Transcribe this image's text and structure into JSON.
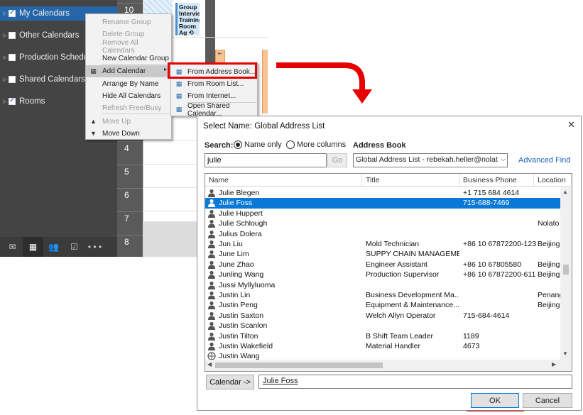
{
  "nav": {
    "folders": [
      {
        "label": "My Calendars",
        "checked": true,
        "selected": true
      },
      {
        "label": "Other Calendars",
        "checked": false,
        "selected": false
      },
      {
        "label": "Production Schedul",
        "checked": false,
        "selected": false
      },
      {
        "label": "Shared Calendars",
        "checked": false,
        "selected": false
      },
      {
        "label": "Rooms",
        "checked": true,
        "selected": false
      }
    ],
    "bar_icons": [
      "mail-icon",
      "calendar-icon",
      "people-icon",
      "tasks-icon",
      "more-icon"
    ],
    "more_glyph": "• • •"
  },
  "calendar": {
    "day_numbers": [
      "10",
      "4",
      "5",
      "6",
      "7",
      "8"
    ],
    "appointment_text": "Group Intervie Training Room",
    "appointment_extra": "Ag ⟲ ⊘"
  },
  "context_menu": {
    "items": [
      {
        "label": "Rename Group",
        "disabled": true
      },
      {
        "label": "Delete Group",
        "disabled": true
      },
      {
        "label": "Remove All Calendars",
        "disabled": true
      },
      {
        "label": "New Calendar Group",
        "disabled": false
      },
      {
        "label": "Add Calendar",
        "disabled": false
      },
      {
        "label": "Arrange By Name",
        "disabled": false
      },
      {
        "label": "Hide All Calendars",
        "disabled": false
      },
      {
        "label": "Refresh Free/Busy",
        "disabled": true
      },
      {
        "label": "Move Up",
        "disabled": true
      },
      {
        "label": "Move Down",
        "disabled": false
      }
    ]
  },
  "submenu": {
    "items": [
      {
        "label": "From Address Book..."
      },
      {
        "label": "From Room List..."
      },
      {
        "label": "From Internet..."
      },
      {
        "label": "Open Shared Calendar..."
      }
    ]
  },
  "dialog": {
    "title": "Select Name: Global Address List",
    "close_glyph": "✕",
    "search_label": "Search:",
    "radio_name_only": "Name only",
    "radio_more_columns": "More columns",
    "address_book_label": "Address Book",
    "search_value": "julie",
    "go_label": "Go",
    "address_book_value": "Global Address List - rebekah.heller@nolat",
    "advanced_find": "Advanced Find",
    "columns": [
      "Name",
      "Title",
      "Business Phone",
      "Location"
    ],
    "rows": [
      {
        "name": "Julie Blegen",
        "title": "",
        "phone": "+1 715 684 4614",
        "location": ""
      },
      {
        "name": "Julie Foss",
        "title": "",
        "phone": "715-688-7469",
        "location": ""
      },
      {
        "name": "Julie Huppert",
        "title": "",
        "phone": "",
        "location": ""
      },
      {
        "name": "Julie Schlough",
        "title": "",
        "phone": "",
        "location": "Nolato"
      },
      {
        "name": "Julius Dolera",
        "title": "",
        "phone": "",
        "location": ""
      },
      {
        "name": "Jun Liu",
        "title": "Mold Technician",
        "phone": "+86 10 67872200-123",
        "location": "Beijing"
      },
      {
        "name": "June Lim",
        "title": "SUPPY CHAIN MANAGEME...",
        "phone": "",
        "location": ""
      },
      {
        "name": "June Zhao",
        "title": "Engineer Assistant",
        "phone": "+86 10 67805580",
        "location": "Beijing"
      },
      {
        "name": "Junling Wang",
        "title": "Production Supervisor",
        "phone": "+86 10 67872200-611",
        "location": "Beijing"
      },
      {
        "name": "Jussi Myllyluoma",
        "title": "",
        "phone": "",
        "location": ""
      },
      {
        "name": "Justin Lin",
        "title": "Business Development Ma...",
        "phone": "",
        "location": "Penang"
      },
      {
        "name": "Justin Peng",
        "title": "Equipment & Maintenance...",
        "phone": "",
        "location": "Beijing"
      },
      {
        "name": "Justin Saxton",
        "title": "Welch Allyn Operator",
        "phone": "715-684-4614",
        "location": ""
      },
      {
        "name": "Justin Scanlon",
        "title": "",
        "phone": "",
        "location": ""
      },
      {
        "name": "Justin Tilton",
        "title": "B Shift Team Leader",
        "phone": "1189",
        "location": ""
      },
      {
        "name": "Justin Wakefield",
        "title": "Material Handler",
        "phone": "4673",
        "location": ""
      },
      {
        "name": "Justin Wang",
        "title": "",
        "phone": "",
        "location": ""
      }
    ],
    "selected_row": 1,
    "calendar_button": "Calendar ->",
    "calendar_value": "Julie Foss",
    "ok": "OK",
    "cancel": "Cancel"
  },
  "colors": {
    "selection": "#0a78d7",
    "highlight_box": "#e60000",
    "nav_selected": "#2566a8",
    "link": "#1a5fb4"
  }
}
